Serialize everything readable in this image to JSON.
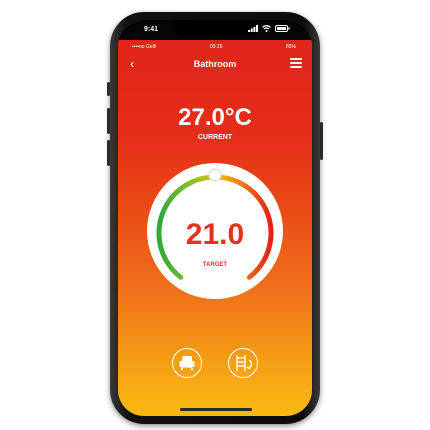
{
  "device": {
    "time": "9:41",
    "frame_color": "#111111"
  },
  "app_status": {
    "carrier": "••••oo Gelli",
    "time": "09:15",
    "battery": "85%"
  },
  "header": {
    "back_icon": "chevron-left-icon",
    "title": "Bathroom",
    "menu_icon": "hamburger-icon"
  },
  "current": {
    "value": "27.0°C",
    "label": "CURRENT"
  },
  "target": {
    "value": "21.0",
    "label": "TARGET"
  },
  "controls": {
    "left_icon": "armchair-icon",
    "right_icon": "ladder-rotate-icon"
  },
  "colors": {
    "bg_top": "#e0231b",
    "bg_bottom": "#f9b90f",
    "target_text": "#e4321c",
    "gauge_green": "#2fa83a",
    "gauge_yellow": "#f1b700",
    "gauge_red": "#e32018"
  }
}
